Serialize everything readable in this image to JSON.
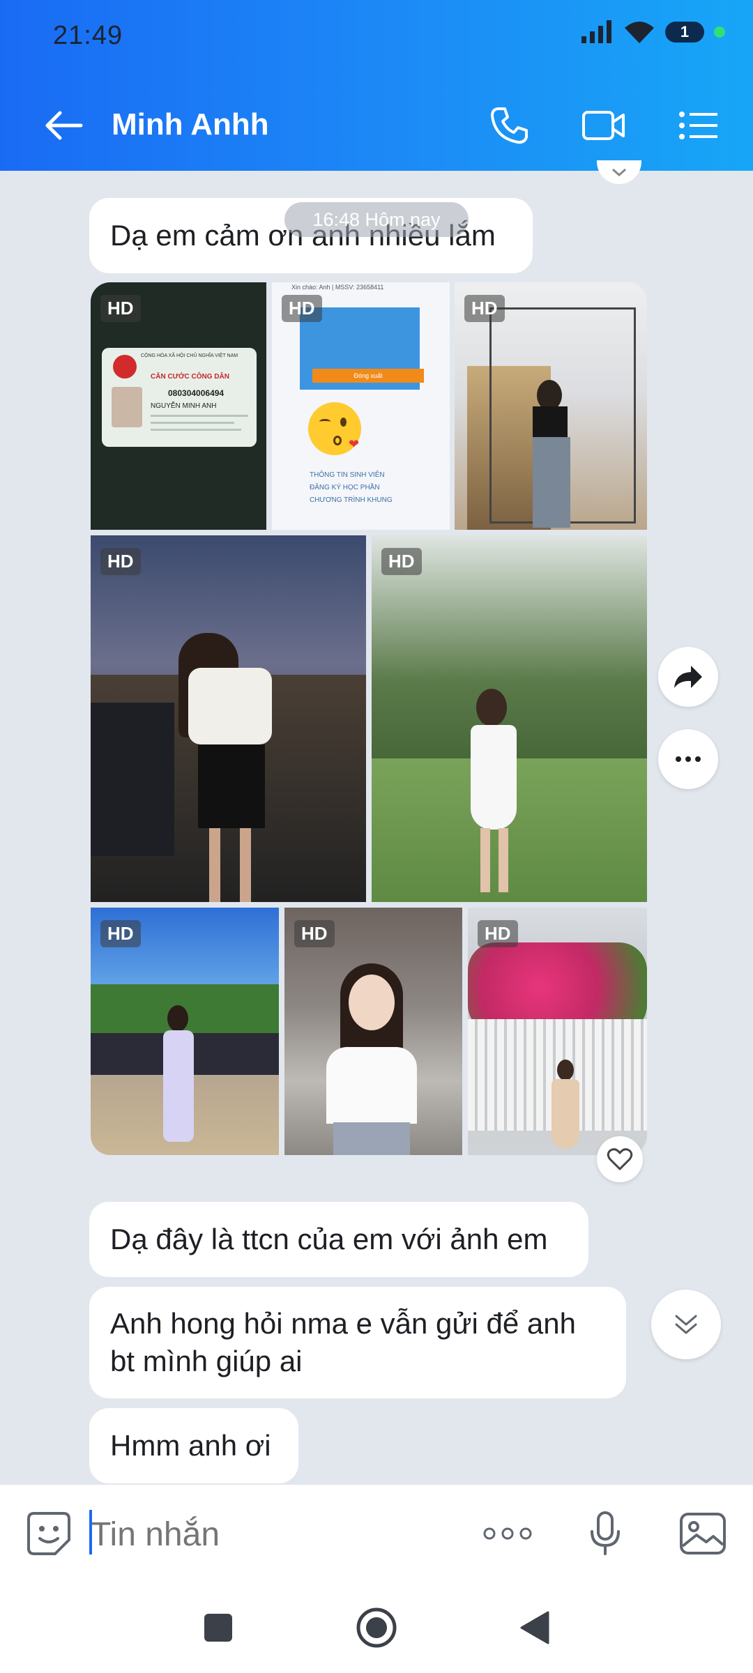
{
  "status_bar": {
    "time": "21:49",
    "notification_count": "1"
  },
  "app_bar": {
    "title": "Minh Anhh"
  },
  "chat": {
    "timestamp": "16:48 Hôm nay",
    "messages": [
      "Dạ em cảm ơn anh nhiều lắm",
      "Dạ đây là ttcn của em với ảnh em",
      "Anh hong hỏi nma e vẫn gửi để anh bt mình giúp ai",
      "Hmm anh ơi"
    ],
    "photo_badge": "HD",
    "id_card": {
      "header": "CỘNG HÒA XÃ HỘI CHỦ NGHĨA VIỆT NAM",
      "title": "CĂN CƯỚC CÔNG DÂN",
      "number": "080304006494",
      "name": "NGUYỄN MINH ANH"
    },
    "student_doc": {
      "greeting": "Xin chào: Anh  |  MSSV: 23658411",
      "button": "Đóng xuất",
      "lines": [
        "THÔNG TIN SINH VIÊN",
        "ĐĂNG KÝ HỌC PHẦN",
        "CHƯƠNG TRÌNH KHUNG"
      ]
    }
  },
  "input": {
    "placeholder": "Tin nhắn"
  },
  "colors": {
    "header_start": "#1a6bf4",
    "header_end": "#17a6f7",
    "background": "#e2e7ee",
    "accent": "#1a6bf4"
  }
}
